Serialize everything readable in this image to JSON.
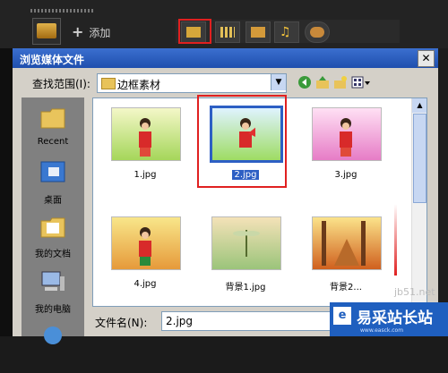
{
  "host": {
    "add_label": "添加"
  },
  "dialog": {
    "title": "浏览媒体文件",
    "close_glyph": "✕",
    "look_in_label": "查找范围(I):",
    "look_in_value": "边框素材",
    "dropdown_glyph": "▼",
    "places": [
      "Recent",
      "桌面",
      "我的文档",
      "我的电脑"
    ],
    "files": [
      {
        "name": "1.jpg",
        "selected": false
      },
      {
        "name": "2.jpg",
        "selected": true
      },
      {
        "name": "3.jpg",
        "selected": false
      },
      {
        "name": "4.jpg",
        "selected": false
      },
      {
        "name": "背景1.jpg",
        "selected": false
      },
      {
        "name": "背景2...",
        "selected": false
      }
    ],
    "filename_label": "文件名(N):",
    "filename_value": "2.jpg",
    "scroll_up_glyph": "▲"
  },
  "watermark": {
    "brand": "易采站长站",
    "logo_char": "e",
    "site": "jb51.net",
    "url": "www.easck.com"
  },
  "icons": [
    "folder-icon",
    "film-icon",
    "photo-icon",
    "music-icon",
    "settings-icon",
    "back-icon",
    "up-folder-icon",
    "new-folder-icon",
    "view-menu-icon"
  ],
  "colors": {
    "title_bar": "#1f4fae",
    "highlight": "#e02020",
    "selection": "#2d5fc4"
  }
}
